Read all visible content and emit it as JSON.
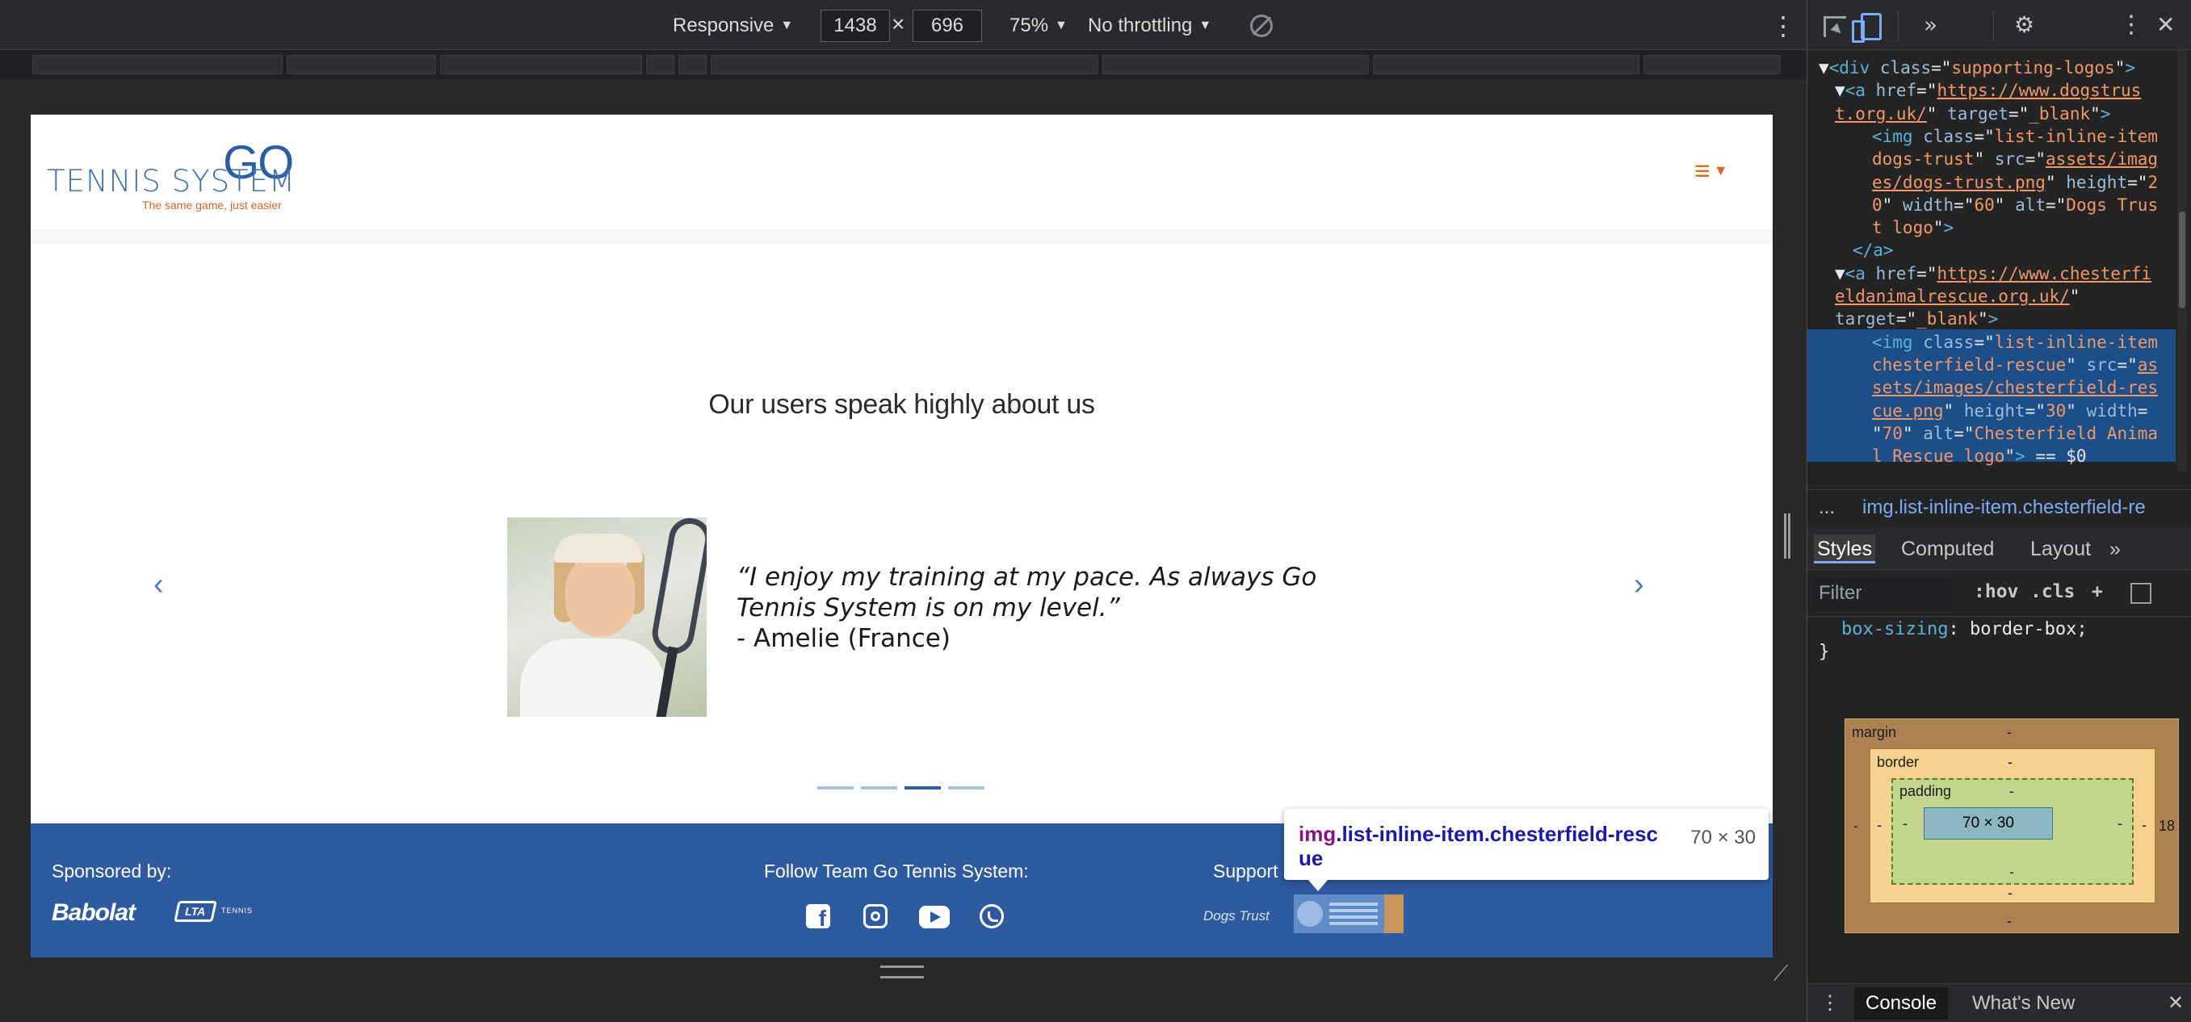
{
  "device_toolbar": {
    "dimension_mode": "Responsive",
    "width": "1438",
    "height": "696",
    "zoom": "75%",
    "throttling": "No throttling"
  },
  "page": {
    "logo": {
      "go": "GO",
      "main": "TENNIS SYSTEM",
      "tagline": "The same game, just easier"
    },
    "menu_icon": "hamburger-icon",
    "testimonial": {
      "heading": "Our users speak highly about us",
      "quote": "“I enjoy my training at my pace. As always Go Tennis System is on my level.”",
      "author": "- Amelie (France)",
      "slide_count": 4,
      "active_slide": 3
    },
    "footer": {
      "sponsored_by": "Sponsored by:",
      "sponsors": [
        "Babolat",
        "LTA"
      ],
      "follow": "Follow Team Go Tennis System:",
      "social": [
        "facebook-icon",
        "instagram-icon",
        "youtube-icon",
        "whatsapp-icon"
      ],
      "supporting": "Support",
      "supporting_logos": [
        "Dogs Trust",
        "Chesterfield Animal Rescue"
      ]
    },
    "inspect_tooltip": {
      "tag": "img",
      "selector": ".list-inline-item.chesterfield-rescue",
      "size": "70 × 30"
    }
  },
  "devtools": {
    "dom_lines": [
      [
        {
          "c": "x",
          "t": "▼"
        },
        {
          "c": "t",
          "t": "<div "
        },
        {
          "c": "a",
          "t": "class"
        },
        {
          "c": "x",
          "t": "=\""
        },
        {
          "c": "v",
          "t": "supporting-logos"
        },
        {
          "c": "x",
          "t": "\""
        },
        {
          "c": "t",
          "t": ">"
        }
      ],
      [
        {
          "c": "x",
          "t": "▼"
        },
        {
          "c": "t",
          "t": "<a "
        },
        {
          "c": "a",
          "t": "href"
        },
        {
          "c": "x",
          "t": "=\""
        },
        {
          "c": "u",
          "t": "https://www.dogstrus"
        }
      ],
      [
        {
          "c": "u",
          "t": "t.org.uk/"
        },
        {
          "c": "x",
          "t": "\" "
        },
        {
          "c": "a",
          "t": "target"
        },
        {
          "c": "x",
          "t": "=\""
        },
        {
          "c": "v",
          "t": "_blank"
        },
        {
          "c": "x",
          "t": "\""
        },
        {
          "c": "t",
          "t": ">"
        }
      ],
      [
        {
          "c": "t",
          "t": "<img "
        },
        {
          "c": "a",
          "t": "class"
        },
        {
          "c": "x",
          "t": "=\""
        },
        {
          "c": "v",
          "t": "list-inline-item"
        }
      ],
      [
        {
          "c": "v",
          "t": "dogs-trust"
        },
        {
          "c": "x",
          "t": "\" "
        },
        {
          "c": "a",
          "t": "src"
        },
        {
          "c": "x",
          "t": "=\""
        },
        {
          "c": "u",
          "t": "assets/imag"
        }
      ],
      [
        {
          "c": "u",
          "t": "es/dogs-trust.png"
        },
        {
          "c": "x",
          "t": "\" "
        },
        {
          "c": "a",
          "t": "height"
        },
        {
          "c": "x",
          "t": "=\""
        },
        {
          "c": "v",
          "t": "2"
        }
      ],
      [
        {
          "c": "v",
          "t": "0"
        },
        {
          "c": "x",
          "t": "\" "
        },
        {
          "c": "a",
          "t": "width"
        },
        {
          "c": "x",
          "t": "=\""
        },
        {
          "c": "v",
          "t": "60"
        },
        {
          "c": "x",
          "t": "\" "
        },
        {
          "c": "a",
          "t": "alt"
        },
        {
          "c": "x",
          "t": "=\""
        },
        {
          "c": "v",
          "t": "Dogs Trus"
        }
      ],
      [
        {
          "c": "v",
          "t": "t logo"
        },
        {
          "c": "x",
          "t": "\""
        },
        {
          "c": "t",
          "t": ">"
        }
      ],
      [
        {
          "c": "t",
          "t": "</a>"
        }
      ],
      [
        {
          "c": "x",
          "t": "▼"
        },
        {
          "c": "t",
          "t": "<a "
        },
        {
          "c": "a",
          "t": "href"
        },
        {
          "c": "x",
          "t": "=\""
        },
        {
          "c": "u",
          "t": "https://www.chesterfi"
        }
      ],
      [
        {
          "c": "u",
          "t": "eldanimalrescue.org.uk/"
        },
        {
          "c": "x",
          "t": "\""
        }
      ],
      [
        {
          "c": "a",
          "t": "target"
        },
        {
          "c": "x",
          "t": "=\""
        },
        {
          "c": "v",
          "t": "_blank"
        },
        {
          "c": "x",
          "t": "\""
        },
        {
          "c": "t",
          "t": ">"
        }
      ],
      [
        {
          "c": "t",
          "t": "<img "
        },
        {
          "c": "a",
          "t": "class"
        },
        {
          "c": "x",
          "t": "=\""
        },
        {
          "c": "v",
          "t": "list-inline-item"
        }
      ],
      [
        {
          "c": "v",
          "t": "chesterfield-rescue"
        },
        {
          "c": "x",
          "t": "\" "
        },
        {
          "c": "a",
          "t": "src"
        },
        {
          "c": "x",
          "t": "=\""
        },
        {
          "c": "u",
          "t": "as"
        }
      ],
      [
        {
          "c": "u",
          "t": "sets/images/chesterfield-res"
        }
      ],
      [
        {
          "c": "u",
          "t": "cue.png"
        },
        {
          "c": "x",
          "t": "\" "
        },
        {
          "c": "a",
          "t": "height"
        },
        {
          "c": "x",
          "t": "=\""
        },
        {
          "c": "v",
          "t": "30"
        },
        {
          "c": "x",
          "t": "\" "
        },
        {
          "c": "a",
          "t": "width"
        },
        {
          "c": "x",
          "t": "="
        }
      ],
      [
        {
          "c": "x",
          "t": "\""
        },
        {
          "c": "v",
          "t": "70"
        },
        {
          "c": "x",
          "t": "\" "
        },
        {
          "c": "a",
          "t": "alt"
        },
        {
          "c": "x",
          "t": "=\""
        },
        {
          "c": "v",
          "t": "Chesterfield Anima"
        }
      ],
      [
        {
          "c": "v",
          "t": "l Rescue logo"
        },
        {
          "c": "x",
          "t": "\""
        },
        {
          "c": "t",
          "t": ">"
        },
        {
          "c": "x",
          "t": " == $0"
        }
      ]
    ],
    "breadcrumb": "img.list-inline-item.chesterfield-re",
    "panel_tabs": [
      "Styles",
      "Computed",
      "Layout"
    ],
    "filter_placeholder": "Filter",
    "filter_buttons": [
      ":hov",
      ".cls",
      "+"
    ],
    "style_rule": {
      "property": "box-sizing",
      "value": "border-box",
      "close": "}"
    },
    "box_model": {
      "margin": "margin",
      "border": "border",
      "padding": "padding",
      "content": "70 × 30",
      "dash": "-",
      "right_margin_value": "18"
    },
    "drawer_tabs": [
      "Console",
      "What's New"
    ]
  }
}
